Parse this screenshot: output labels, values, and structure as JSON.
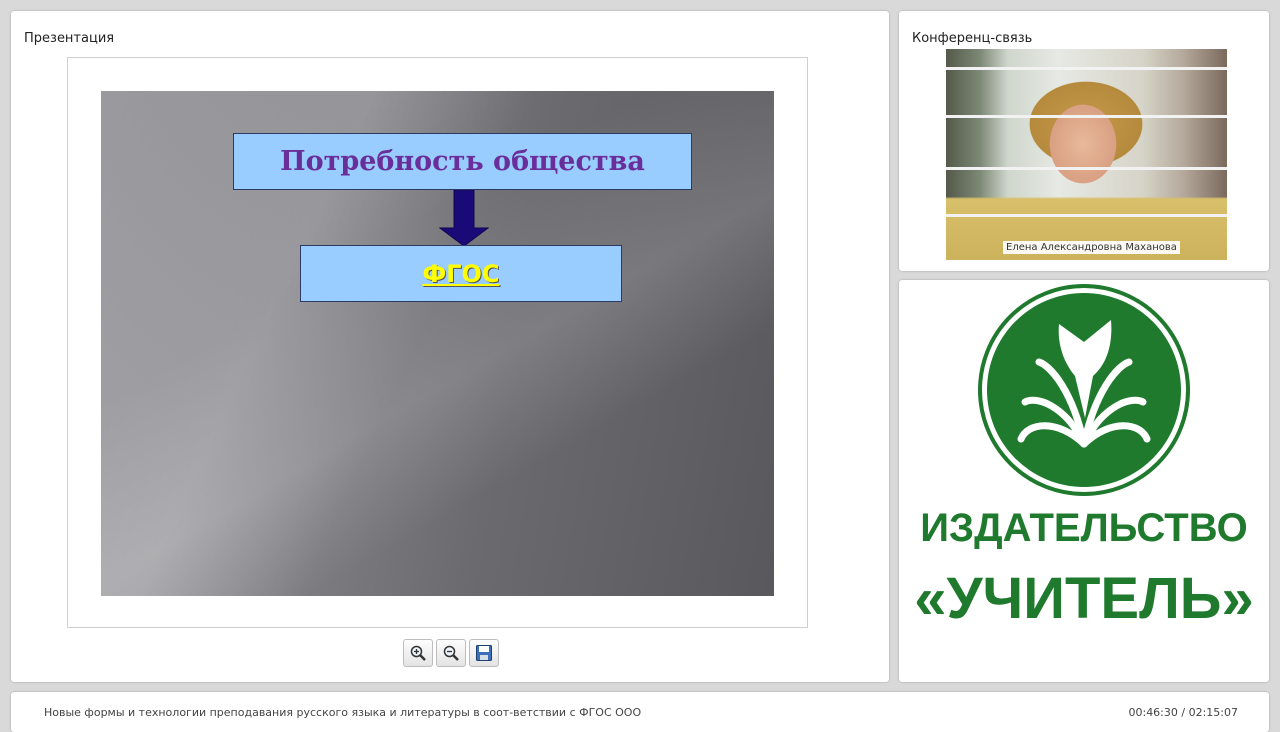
{
  "presentation": {
    "title": "Презентация",
    "slide": {
      "box_top": "Потребность общества",
      "box_bottom": "ФГОС"
    },
    "toolbar": {
      "zoom_in_icon": "zoom-in-icon",
      "zoom_out_icon": "zoom-out-icon",
      "save_icon": "save-icon"
    }
  },
  "conference": {
    "title": "Конференц-связь",
    "speaker_name": "Елена Александровна Маханова"
  },
  "logo": {
    "line1": "ИЗДАТЕЛЬСТВО",
    "line2": "«УЧИТЕЛЬ»",
    "color": "#1f7a2e"
  },
  "footer": {
    "course_title": "Новые формы и технологии преподавания русского языка и литературы в соот-ветствии с ФГОС ООО",
    "timecode": "00:46:30 / 02:15:07"
  }
}
